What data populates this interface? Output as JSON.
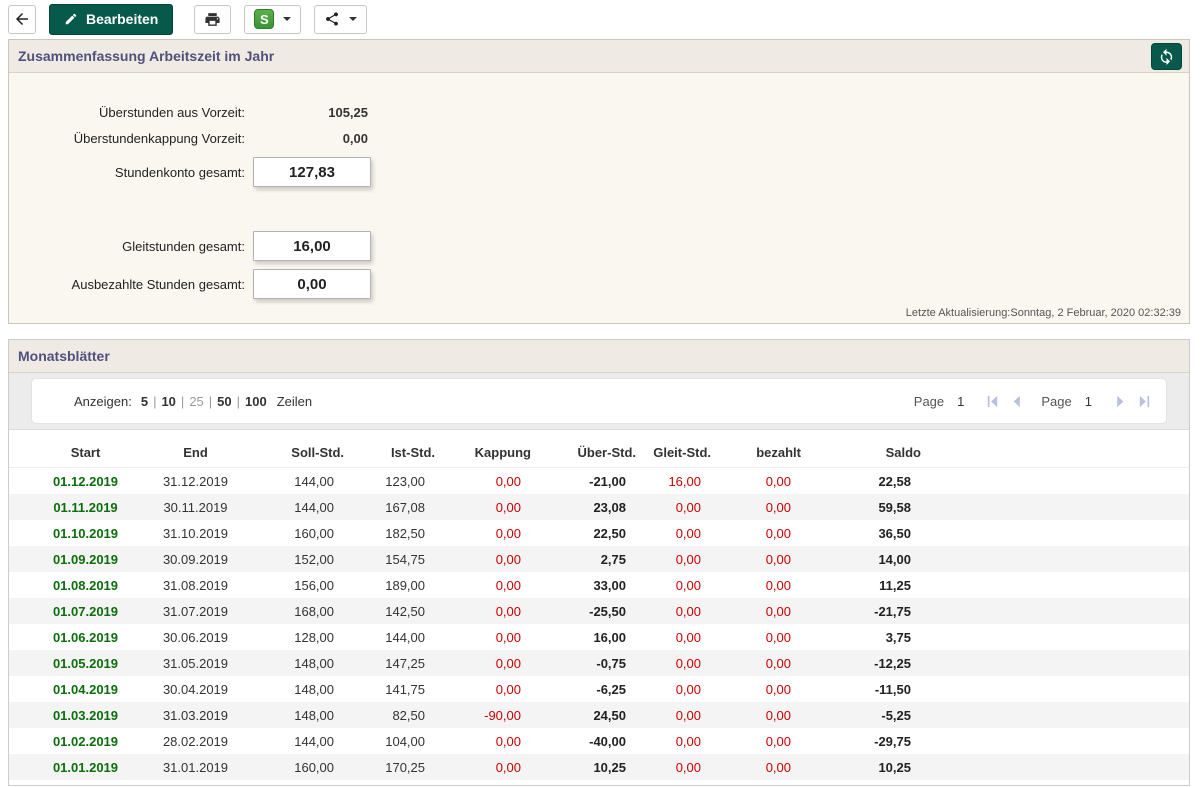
{
  "toolbar": {
    "edit_label": "Bearbeiten",
    "s_badge_letter": "S"
  },
  "summary_panel": {
    "title": "Zusammenfassung Arbeitszeit im Jahr",
    "overtime_prev": {
      "label": "Überstunden aus Vorzeit:",
      "value": "105,25"
    },
    "capping_prev": {
      "label": "Überstundenkappung Vorzeit:",
      "value": "0,00"
    },
    "stundenkonto": {
      "label": "Stundenkonto gesamt:",
      "value": "127,83"
    },
    "gleitstunden": {
      "label": "Gleitstunden gesamt:",
      "value": "16,00"
    },
    "ausbezahlt": {
      "label": "Ausbezahlte Stunden gesamt:",
      "value": "0,00"
    },
    "last_update": "Letzte Aktualisierung:Sonntag, 2 Februar, 2020 02:32:39"
  },
  "months_panel": {
    "title": "Monatsblätter",
    "pager": {
      "show_label": "Anzeigen:",
      "page_sizes": [
        "5",
        "10",
        "25",
        "50",
        "100"
      ],
      "active_size": "25",
      "rows_label": "Zeilen",
      "page_label_left": "Page",
      "page_value_left": "1",
      "page_label_right": "Page",
      "page_value_right": "1"
    },
    "table": {
      "columns": [
        "Start",
        "End",
        "Soll-Std.",
        "Ist-Std.",
        "Kappung",
        "Über-Std.",
        "Gleit-Std.",
        "bezahlt",
        "Saldo"
      ],
      "rows": [
        [
          "01.12.2019",
          "31.12.2019",
          "144,00",
          "123,00",
          "0,00",
          "-21,00",
          "16,00",
          "0,00",
          "22,58"
        ],
        [
          "01.11.2019",
          "30.11.2019",
          "144,00",
          "167,08",
          "0,00",
          "23,08",
          "0,00",
          "0,00",
          "59,58"
        ],
        [
          "01.10.2019",
          "31.10.2019",
          "160,00",
          "182,50",
          "0,00",
          "22,50",
          "0,00",
          "0,00",
          "36,50"
        ],
        [
          "01.09.2019",
          "30.09.2019",
          "152,00",
          "154,75",
          "0,00",
          "2,75",
          "0,00",
          "0,00",
          "14,00"
        ],
        [
          "01.08.2019",
          "31.08.2019",
          "156,00",
          "189,00",
          "0,00",
          "33,00",
          "0,00",
          "0,00",
          "11,25"
        ],
        [
          "01.07.2019",
          "31.07.2019",
          "168,00",
          "142,50",
          "0,00",
          "-25,50",
          "0,00",
          "0,00",
          "-21,75"
        ],
        [
          "01.06.2019",
          "30.06.2019",
          "128,00",
          "144,00",
          "0,00",
          "16,00",
          "0,00",
          "0,00",
          "3,75"
        ],
        [
          "01.05.2019",
          "31.05.2019",
          "148,00",
          "147,25",
          "0,00",
          "-0,75",
          "0,00",
          "0,00",
          "-12,25"
        ],
        [
          "01.04.2019",
          "30.04.2019",
          "148,00",
          "141,75",
          "0,00",
          "-6,25",
          "0,00",
          "0,00",
          "-11,50"
        ],
        [
          "01.03.2019",
          "31.03.2019",
          "148,00",
          "82,50",
          "-90,00",
          "24,50",
          "0,00",
          "0,00",
          "-5,25"
        ],
        [
          "01.02.2019",
          "28.02.2019",
          "144,00",
          "104,00",
          "0,00",
          "-40,00",
          "0,00",
          "0,00",
          "-29,75"
        ],
        [
          "01.01.2019",
          "31.01.2019",
          "160,00",
          "170,25",
          "0,00",
          "10,25",
          "0,00",
          "0,00",
          "10,25"
        ]
      ]
    }
  }
}
